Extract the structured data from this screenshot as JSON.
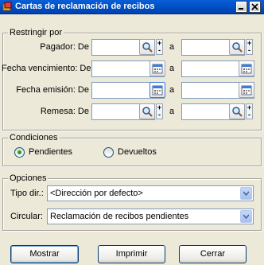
{
  "window": {
    "title": "Cartas de reclamación de recibos"
  },
  "restringir": {
    "legend": "Restringir por",
    "rows": [
      {
        "label": "Pagador: De",
        "from_value": "",
        "sep": "a",
        "to_value": "",
        "icon": "search-icon"
      },
      {
        "label": "Fecha vencimiento: De",
        "from_value": "",
        "sep": "a",
        "to_value": "",
        "icon": "calendar-icon"
      },
      {
        "label": "Fecha emisión: De",
        "from_value": "",
        "sep": "a",
        "to_value": "",
        "icon": "calendar-icon"
      },
      {
        "label": "Remesa: De",
        "from_value": "",
        "sep": "a",
        "to_value": "",
        "icon": "search-icon"
      }
    ]
  },
  "condiciones": {
    "legend": "Condiciones",
    "options": [
      {
        "label": "Pendientes",
        "selected": true
      },
      {
        "label": "Devueltos",
        "selected": false
      }
    ]
  },
  "opciones": {
    "legend": "Opciones",
    "tipo_label": "Tipo dir.:",
    "tipo_value": "<Dirección por defecto>",
    "circular_label": "Circular:",
    "circular_value": "Reclamación de recibos pendientes"
  },
  "buttons": {
    "mostrar": "Mostrar",
    "imprimir": "Imprimir",
    "cerrar": "Cerrar"
  },
  "colors": {
    "titlebar": "#0053c8",
    "selected_radio": "#21a121",
    "field_border": "#7f9db9"
  }
}
